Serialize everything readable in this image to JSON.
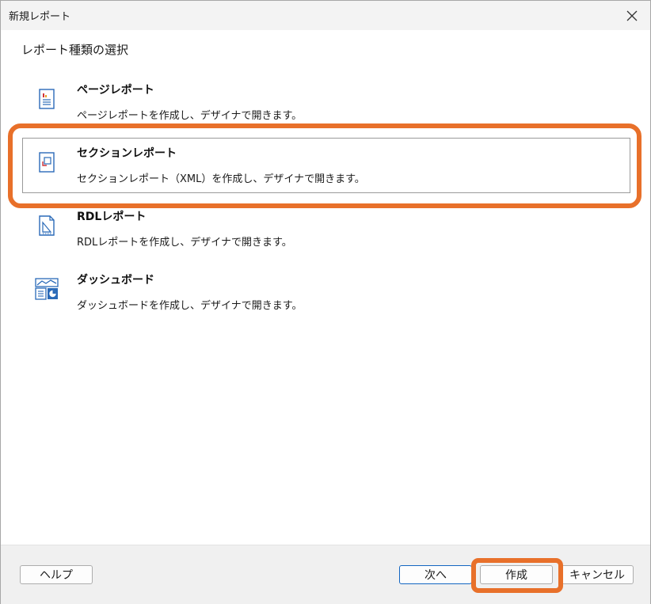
{
  "window": {
    "title": "新規レポート"
  },
  "heading": "レポート種類の選択",
  "items": [
    {
      "title": "ページレポート",
      "description": "ページレポートを作成し、デザイナで開きます。",
      "icon": "page-report-icon"
    },
    {
      "title": "セクションレポート",
      "description": "セクションレポート（XML）を作成し、デザイナで開きます。",
      "icon": "section-report-icon"
    },
    {
      "title": "RDLレポート",
      "description": "RDLレポートを作成し、デザイナで開きます。",
      "icon": "rdl-report-icon"
    },
    {
      "title": "ダッシュボード",
      "description": "ダッシュボードを作成し、デザイナで開きます。",
      "icon": "dashboard-icon"
    }
  ],
  "selected_index": 1,
  "buttons": {
    "help": "ヘルプ",
    "next": "次へ",
    "create": "作成",
    "cancel": "キャンセル"
  },
  "colors": {
    "highlight": "#e8702a",
    "icon_blue": "#2a6ab8",
    "icon_red": "#d13438",
    "primary_border": "#1366c1"
  }
}
